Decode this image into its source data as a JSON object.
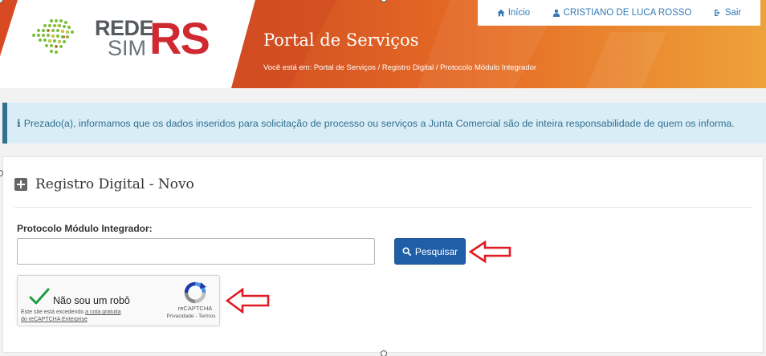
{
  "header": {
    "logo": {
      "line1": "REDE",
      "line2": "SIM",
      "suffix": "RS"
    },
    "portal_title": "Portal de Serviços",
    "breadcrumb": "Você está em: Portal de Serviços / Registro Digital / Protocolo Módulo Integrador",
    "nav": {
      "home_label": "Início",
      "user_label": "CRISTIANO DE LUCA ROSSO",
      "logout_label": "Sair"
    }
  },
  "alert": {
    "icon": "i",
    "text": "Prezado(a), informamos que os dados inseridos para solicitação de processo ou serviços a Junta Comercial são de inteira responsabilidade de quem os informa."
  },
  "panel": {
    "title": "Registro Digital - Novo",
    "field_label": "Protocolo Módulo Integrador:",
    "input_value": "",
    "search_label": "Pesquisar"
  },
  "captcha": {
    "label": "Não sou um robô",
    "warning_prefix": "Este site está excedendo ",
    "warning_link": "a cota gratuita",
    "warning_link2": "do reCAPTCHA Enterprise",
    "brand": "reCAPTCHA",
    "links": "Privacidade - Termos"
  },
  "colors": {
    "brand_red": "#cf2a31",
    "banner_orange": "#e56a25",
    "link_blue": "#337ab7",
    "button_blue": "#1e5fa8",
    "alert_bg": "#d9edf7",
    "arrow_red": "#e21b22"
  },
  "icons": {
    "home": "home-icon",
    "user": "user-icon",
    "logout": "logout-icon",
    "info": "info-icon",
    "plus": "plus-square-icon",
    "search": "search-icon",
    "check": "checkmark-icon",
    "recaptcha": "recaptcha-logo-icon",
    "arrow": "arrow-left-icon"
  }
}
